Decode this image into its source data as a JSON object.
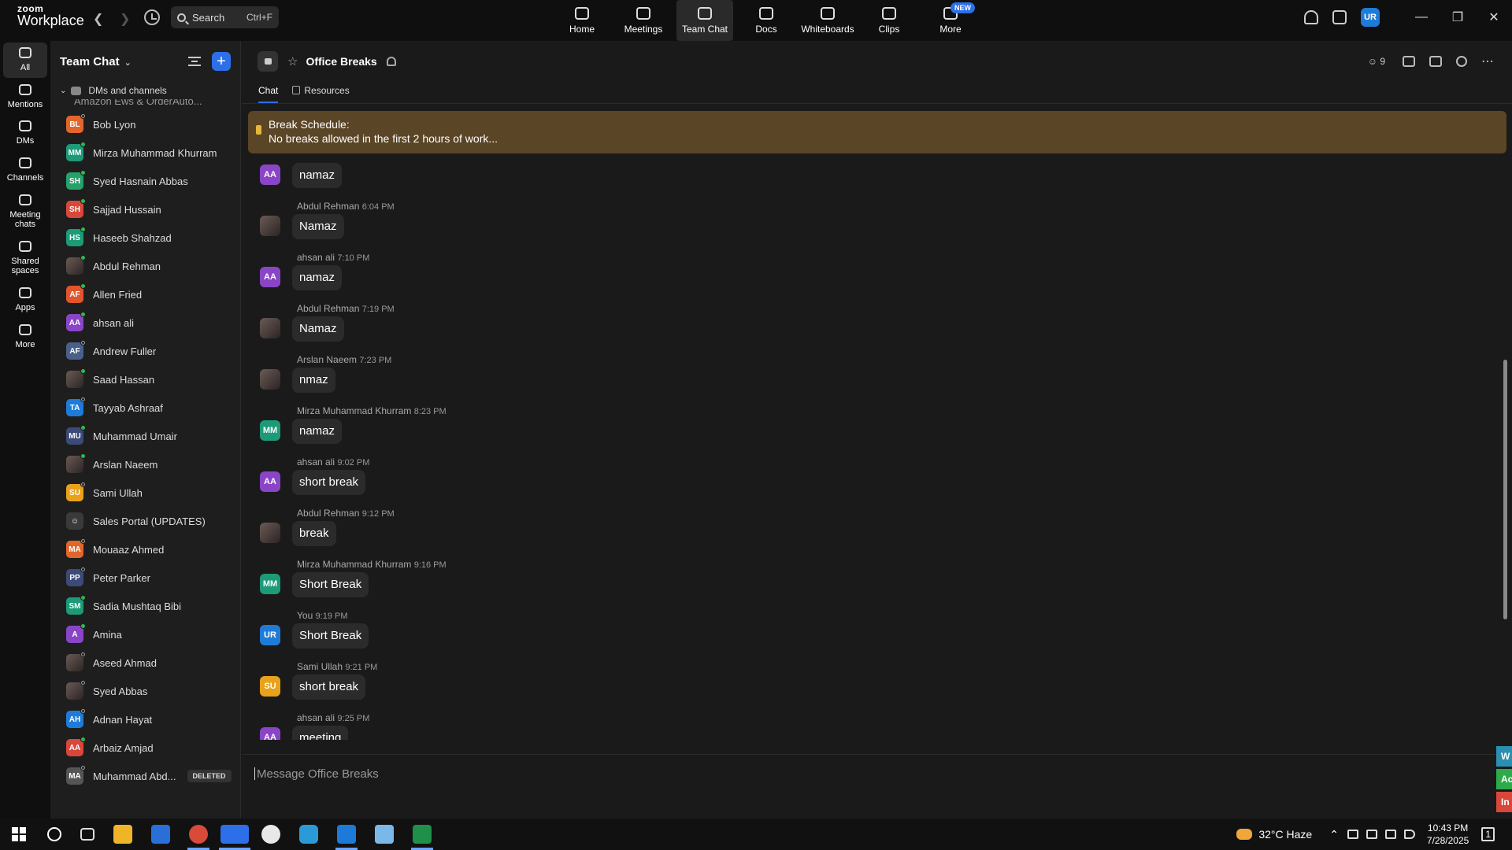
{
  "app": {
    "brand_top": "zoom",
    "brand_bottom": "Workplace"
  },
  "search": {
    "label": "Search",
    "shortcut": "Ctrl+F"
  },
  "nav": [
    {
      "label": "Home",
      "icon": "home-icon",
      "active": false
    },
    {
      "label": "Meetings",
      "icon": "video-icon",
      "active": false
    },
    {
      "label": "Team Chat",
      "icon": "chat-icon",
      "active": true
    },
    {
      "label": "Docs",
      "icon": "doc-icon",
      "active": false
    },
    {
      "label": "Whiteboards",
      "icon": "whiteboard-icon",
      "active": false
    },
    {
      "label": "Clips",
      "icon": "clip-icon",
      "active": false
    },
    {
      "label": "More",
      "icon": "more-icon",
      "active": false,
      "badge": "NEW"
    }
  ],
  "user": {
    "initials": "UR"
  },
  "rail": [
    {
      "label": "All",
      "active": true
    },
    {
      "label": "Mentions",
      "active": false
    },
    {
      "label": "DMs",
      "active": false
    },
    {
      "label": "Channels",
      "active": false
    },
    {
      "label": "Meeting chats",
      "active": false
    },
    {
      "label": "Shared spaces",
      "active": false
    },
    {
      "label": "Apps",
      "active": false
    },
    {
      "label": "More",
      "active": false
    }
  ],
  "sidebar": {
    "title": "Team Chat",
    "section": "DMs and channels",
    "cut_item": "Amazon Ews & OrderAuto...",
    "contacts": [
      {
        "name": "Bob Lyon",
        "initials": "BL",
        "color": "#e0662c",
        "online": false
      },
      {
        "name": "Mirza Muhammad Khurram",
        "initials": "MM",
        "color": "#1d9a78",
        "online": true
      },
      {
        "name": "Syed Hasnain Abbas",
        "initials": "SH",
        "color": "#27a06a",
        "online": true
      },
      {
        "name": "Sajjad Hussain",
        "initials": "SH",
        "color": "#d8473a",
        "online": true
      },
      {
        "name": "Haseeb Shahzad",
        "initials": "HS",
        "color": "#1d9a78",
        "online": true
      },
      {
        "name": "Abdul Rehman",
        "initials": "",
        "color": "photo",
        "online": true
      },
      {
        "name": "Allen Fried",
        "initials": "AF",
        "color": "#e0552c",
        "online": true
      },
      {
        "name": "ahsan ali",
        "initials": "AA",
        "color": "#8a45c7",
        "online": true
      },
      {
        "name": "Andrew Fuller",
        "initials": "AF",
        "color": "#4a5f8a",
        "online": false
      },
      {
        "name": "Saad Hassan",
        "initials": "",
        "color": "photo",
        "online": true
      },
      {
        "name": "Tayyab Ashraaf",
        "initials": "TA",
        "color": "#1f7bd8",
        "online": false
      },
      {
        "name": "Muhammad Umair",
        "initials": "MU",
        "color": "#3c4a78",
        "online": true
      },
      {
        "name": "Arslan Naeem",
        "initials": "",
        "color": "photo",
        "online": true
      },
      {
        "name": "Sami Ullah",
        "initials": "SU",
        "color": "#e8a21a",
        "online": false
      },
      {
        "name": "Sales Portal (UPDATES)",
        "initials": "",
        "color": "group",
        "online": false
      },
      {
        "name": "Mouaaz Ahmed",
        "initials": "MA",
        "color": "#e0662c",
        "online": false
      },
      {
        "name": "Peter Parker",
        "initials": "PP",
        "color": "#3c4a78",
        "online": false
      },
      {
        "name": "Sadia Mushtaq Bibi",
        "initials": "SM",
        "color": "#1d9a78",
        "online": true
      },
      {
        "name": "Amina",
        "initials": "A",
        "color": "#8a45c7",
        "online": true
      },
      {
        "name": "Aseed Ahmad",
        "initials": "",
        "color": "photo",
        "online": false
      },
      {
        "name": "Syed Abbas",
        "initials": "",
        "color": "photo",
        "online": false
      },
      {
        "name": "Adnan Hayat",
        "initials": "AH",
        "color": "#1f7bd8",
        "online": false
      },
      {
        "name": "Arbaiz Amjad",
        "initials": "AA",
        "color": "#d8473a",
        "online": true
      },
      {
        "name": "Muhammad Abd...",
        "initials": "MA",
        "color": "#555",
        "online": false,
        "badge": "DELETED"
      }
    ]
  },
  "channel": {
    "name": "Office Breaks",
    "members": "9",
    "tabs": [
      "Chat",
      "Resources"
    ],
    "pinned_title": "Break Schedule:",
    "pinned_text": "No breaks allowed in the first 2 hours of work...",
    "composer_placeholder": "Message Office Breaks"
  },
  "messages": [
    {
      "author": "",
      "time": "",
      "text": "namaz",
      "initials": "AA",
      "color": "#8a45c7"
    },
    {
      "author": "Abdul Rehman",
      "time": "6:04 PM",
      "text": "Namaz",
      "initials": "",
      "color": "photo"
    },
    {
      "author": "ahsan ali",
      "time": "7:10 PM",
      "text": "namaz",
      "initials": "AA",
      "color": "#8a45c7"
    },
    {
      "author": "Abdul Rehman",
      "time": "7:19 PM",
      "text": "Namaz",
      "initials": "",
      "color": "photo"
    },
    {
      "author": "Arslan Naeem",
      "time": "7:23 PM",
      "text": "nmaz",
      "initials": "",
      "color": "photo"
    },
    {
      "author": "Mirza Muhammad Khurram",
      "time": "8:23 PM",
      "text": "namaz",
      "initials": "MM",
      "color": "#1d9a78"
    },
    {
      "author": "ahsan ali",
      "time": "9:02 PM",
      "text": "short break",
      "initials": "AA",
      "color": "#8a45c7"
    },
    {
      "author": "Abdul Rehman",
      "time": "9:12 PM",
      "text": "break",
      "initials": "",
      "color": "photo"
    },
    {
      "author": "Mirza Muhammad Khurram",
      "time": "9:16 PM",
      "text": "Short Break",
      "initials": "MM",
      "color": "#1d9a78"
    },
    {
      "author": "You",
      "time": "9:19 PM",
      "text": "Short Break",
      "initials": "UR",
      "color": "#1f7bd8"
    },
    {
      "author": "Sami Ullah",
      "time": "9:21 PM",
      "text": "short break",
      "initials": "SU",
      "color": "#e8a21a"
    },
    {
      "author": "ahsan ali",
      "time": "9:25 PM",
      "text": "meeting",
      "initials": "AA",
      "color": "#8a45c7"
    }
  ],
  "edge_buttons": [
    {
      "label": "W",
      "color": "#2b8fb0"
    },
    {
      "label": "Ac",
      "color": "#2eaa4b"
    },
    {
      "label": "In",
      "color": "#d8473a"
    }
  ],
  "taskbar": {
    "weather": "32°C  Haze",
    "time": "10:43 PM",
    "date": "7/28/2025",
    "notifications": "1"
  }
}
